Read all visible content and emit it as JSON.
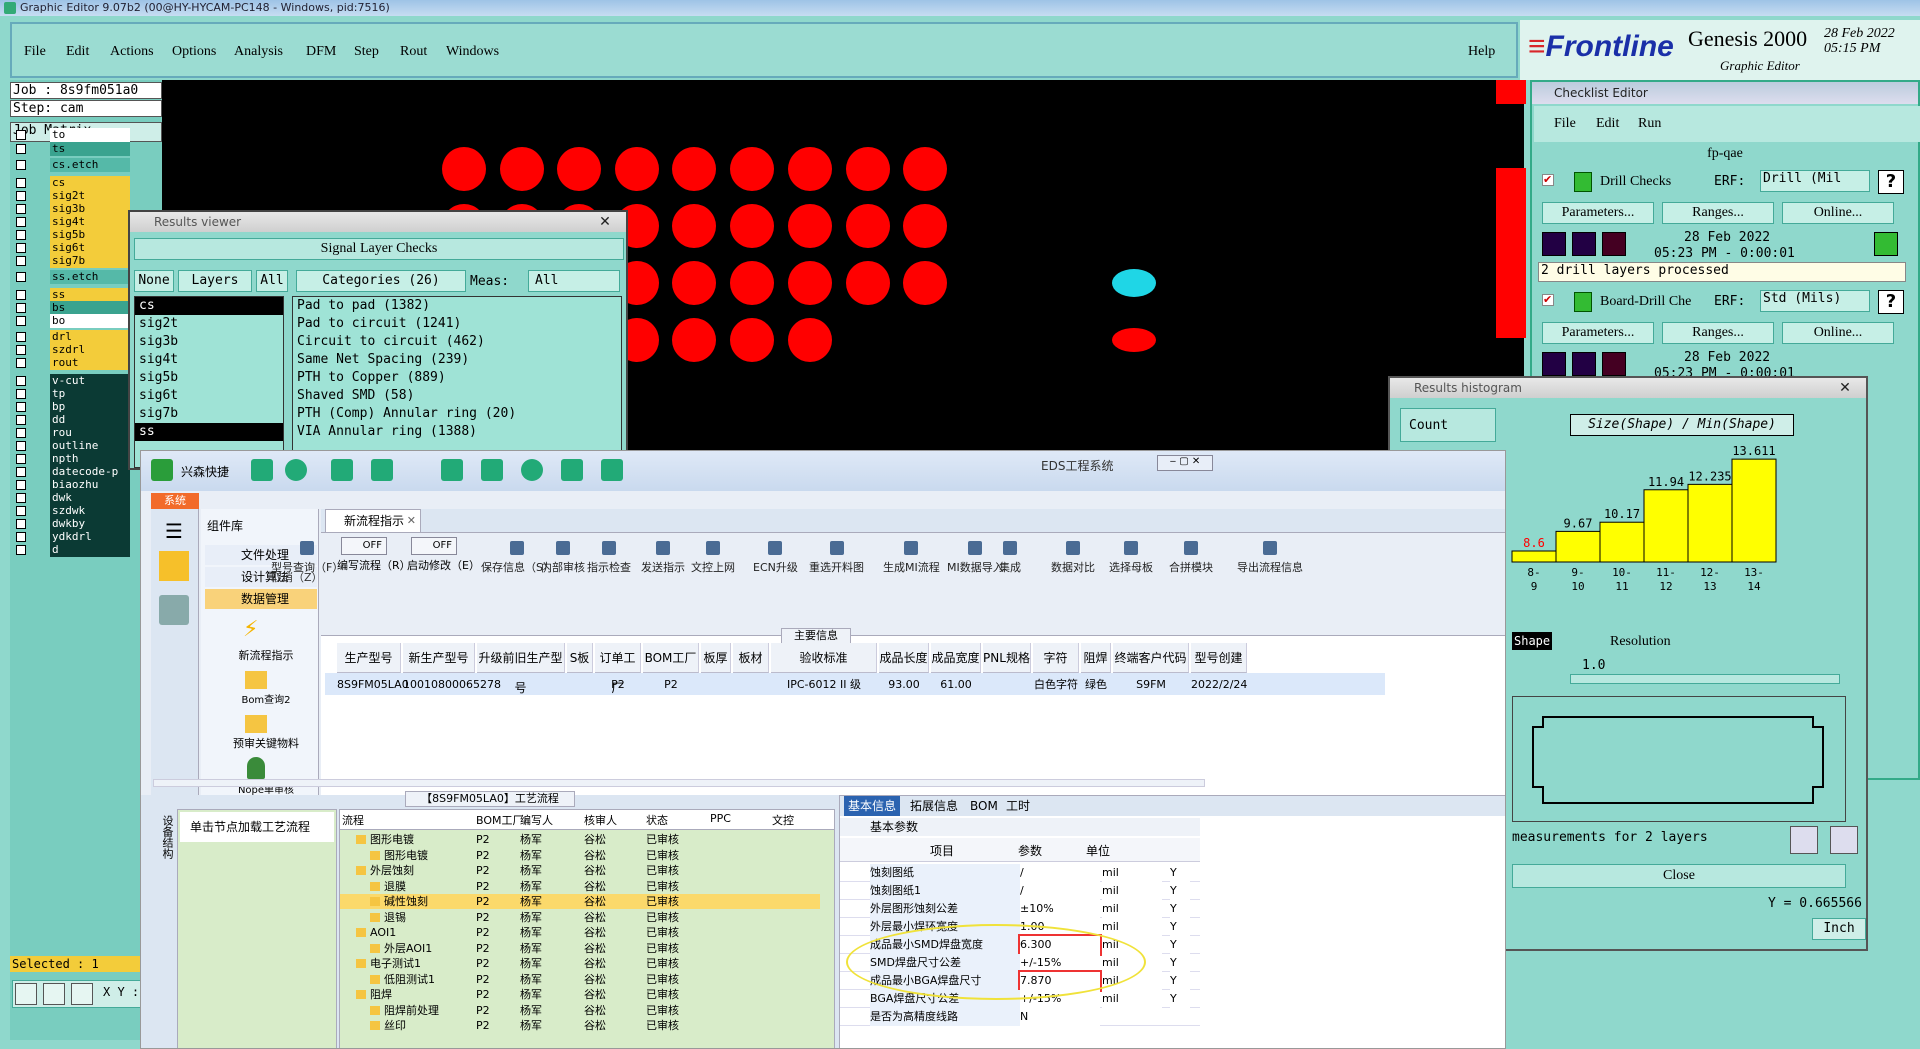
{
  "titlebar": {
    "text": "Graphic Editor 9.07b2 (00@HY-HYCAM-PC148 - Windows, pid:7516)"
  },
  "menu": {
    "items": [
      "File",
      "Edit",
      "Actions",
      "Options",
      "Analysis",
      "DFM",
      "Step",
      "Rout",
      "Windows"
    ],
    "help": "Help"
  },
  "logo": {
    "brand_a": "Frontline",
    "product": "Genesis 2000",
    "date": "28 Feb 2022",
    "time": "05:15 PM",
    "sub": "Graphic Editor"
  },
  "job": {
    "job_line": "Job : 8s9fm051a0",
    "step_line": "Step: cam",
    "matrix_btn": "Job Matrix ..."
  },
  "layers": [
    "to",
    "ts",
    "cs.etch",
    "cs",
    "sig2t",
    "sig3b",
    "sig4t",
    "sig5b",
    "sig6t",
    "sig7b",
    "ss.etch",
    "ss",
    "bs",
    "bo",
    "drl",
    "szdrl",
    "rout",
    "v-cut",
    "tp",
    "bp",
    "dd",
    "rou",
    "outline",
    "npth",
    "datecode-p",
    "biaozhu",
    "dwk",
    "szdwk",
    "dwkby",
    "ydkdrl",
    "d"
  ],
  "status": {
    "selected": "Selected : 1",
    "xy": "X Y :"
  },
  "checklist": {
    "title": "Checklist Editor",
    "menu": [
      "File",
      "Edit",
      "Run"
    ],
    "name": "fp-qae",
    "check1": {
      "name": "Drill Checks",
      "erf": "ERF:",
      "erf_val": "Drill (Mil",
      "params": "Parameters...",
      "ranges": "Ranges...",
      "online": "Online...",
      "date": "28 Feb 2022",
      "time": "05:23 PM - 0:00:01",
      "msg": "2 drill layers processed"
    },
    "check2": {
      "name": "Board-Drill Che",
      "erf": "ERF:",
      "erf_val": "Std (Mils)",
      "params": "Parameters...",
      "ranges": "Ranges...",
      "online": "Online...",
      "date": "28 Feb 2022",
      "time": "05:23 PM - 0:00:01"
    }
  },
  "results_viewer": {
    "title": "Results viewer",
    "section": "Signal Layer Checks",
    "none": "None",
    "layers": "Layers",
    "all": "All",
    "categories": "Categories (26)",
    "meas": "Meas:",
    "meas_val": "All",
    "layer_list": [
      "cs",
      "sig2t",
      "sig3b",
      "sig4t",
      "sig5b",
      "sig6t",
      "sig7b",
      "ss"
    ],
    "category_list": [
      "Pad to pad (1382)",
      "Pad to circuit (1241)",
      "Circuit to circuit (462)",
      "Same Net Spacing (239)",
      "PTH to Copper (889)",
      "Shaved SMD (58)",
      "PTH (Comp) Annular ring (20)",
      "VIA Annular ring (1388)"
    ]
  },
  "histogram": {
    "title": "Results histogram",
    "count": "Count",
    "heading": "Size(Shape) / Min(Shape)",
    "resolution_label": "Resolution",
    "resolution_val": "1.0",
    "shape": "Shape",
    "measurements": "measurements for 2 layers",
    "close": "Close",
    "inch": "Inch",
    "yreadout": "Y = 0.665566"
  },
  "chart_data": {
    "type": "bar",
    "categories": [
      "8-9",
      "9-10",
      "10-11",
      "11-12",
      "12-13",
      "13-14"
    ],
    "values": [
      8.6,
      9.67,
      10.17,
      11.94,
      12.235,
      13.611
    ],
    "title": "Size(Shape) / Min(Shape)",
    "xlabel": "",
    "ylabel": ""
  },
  "eds": {
    "title": "EDS工程系统",
    "app": "兴森快捷",
    "side_tab": "系统",
    "lib": "组件库",
    "side_items": [
      "文件处理",
      "设计算法",
      "数据管理"
    ],
    "side_tools": [
      "新流程指示",
      "Bom查询2",
      "预审关键物料",
      "Nope单审核"
    ],
    "doc_tab": "新流程指示",
    "toggles": [
      {
        "label": "编写流程（R）",
        "state": "OFF"
      },
      {
        "label": "启动修改（E）",
        "state": "OFF"
      }
    ],
    "toolbar": [
      "型号查询（F）",
      "保存信息（S）",
      "内部审核",
      "指示检查",
      "发送指示",
      "文控上网",
      "ECN升级",
      "重选开料图",
      "生成MI流程",
      "MI数据导入",
      "集成",
      "数据对比",
      "选择母板",
      "合拼模块",
      "导出流程信息"
    ],
    "cancel": "取消（Z）",
    "main_info": "主要信息",
    "grid_headers": [
      "生产型号",
      "新生产型号",
      "升级前旧生产型号",
      "S板",
      "订单工厂",
      "BOM工厂",
      "板厚",
      "板材",
      "验收标准",
      "成品长度",
      "成品宽度",
      "PNL规格",
      "字符",
      "阻焊",
      "终端客户代码",
      "型号创建"
    ],
    "grid_row": [
      "8S9FM05LA0",
      "10010800065278",
      "",
      "",
      "P2",
      "P2",
      "",
      "",
      "IPC-6012 II 级",
      "93.00",
      "61.00",
      "",
      "白色字符",
      "绿色",
      "S9FM",
      "2022/2/24"
    ],
    "flow_title": "【8S9FM05LA0】工艺流程",
    "flow_hint": "单击节点加载工艺流程",
    "device_tab": "设备结构",
    "flow_headers": [
      "流程",
      "BOM工厂",
      "编写人",
      "核审人",
      "状态",
      "PPC",
      "文控"
    ],
    "flow_rows": [
      {
        "name": "图形电镀",
        "lvl": 1,
        "f": "P2",
        "w": "杨军",
        "r": "谷松",
        "s": "已审核"
      },
      {
        "name": "图形电镀",
        "lvl": 2,
        "f": "P2",
        "w": "杨军",
        "r": "谷松",
        "s": "已审核"
      },
      {
        "name": "外层蚀刻",
        "lvl": 1,
        "f": "P2",
        "w": "杨军",
        "r": "谷松",
        "s": "已审核"
      },
      {
        "name": "退膜",
        "lvl": 2,
        "f": "P2",
        "w": "杨军",
        "r": "谷松",
        "s": "已审核"
      },
      {
        "name": "碱性蚀刻",
        "lvl": 2,
        "f": "P2",
        "w": "杨军",
        "r": "谷松",
        "s": "已审核"
      },
      {
        "name": "退锡",
        "lvl": 2,
        "f": "P2",
        "w": "杨军",
        "r": "谷松",
        "s": "已审核"
      },
      {
        "name": "AOI1",
        "lvl": 1,
        "f": "P2",
        "w": "杨军",
        "r": "谷松",
        "s": "已审核"
      },
      {
        "name": "外层AOI1",
        "lvl": 2,
        "f": "P2",
        "w": "杨军",
        "r": "谷松",
        "s": "已审核"
      },
      {
        "name": "电子测试1",
        "lvl": 1,
        "f": "P2",
        "w": "杨军",
        "r": "谷松",
        "s": "已审核"
      },
      {
        "name": "低阻测试1",
        "lvl": 2,
        "f": "P2",
        "w": "杨军",
        "r": "谷松",
        "s": "已审核"
      },
      {
        "name": "阻焊",
        "lvl": 1,
        "f": "P2",
        "w": "杨军",
        "r": "谷松",
        "s": "已审核"
      },
      {
        "name": "阻焊前处理",
        "lvl": 2,
        "f": "P2",
        "w": "杨军",
        "r": "谷松",
        "s": "已审核"
      },
      {
        "name": "丝印",
        "lvl": 2,
        "f": "P2",
        "w": "杨军",
        "r": "谷松",
        "s": "已审核"
      }
    ],
    "prop_tabs": [
      "基本信息",
      "拓展信息",
      "BOM",
      "工时"
    ],
    "prop_section": "基本参数",
    "prop_headers": [
      "项目",
      "参数",
      "单位"
    ],
    "props": [
      {
        "k": "蚀刻图纸",
        "v": "/",
        "u": "mil",
        "y": "Y"
      },
      {
        "k": "蚀刻图纸1",
        "v": "/",
        "u": "mil",
        "y": "Y"
      },
      {
        "k": "外层图形蚀刻公差",
        "v": "±10%",
        "u": "mil",
        "y": "Y"
      },
      {
        "k": "外层最小焊环宽度",
        "v": "1.00",
        "u": "mil",
        "y": "Y"
      },
      {
        "k": "成品最小SMD焊盘宽度",
        "v": "6.300",
        "u": "mil",
        "y": "Y"
      },
      {
        "k": "SMD焊盘尺寸公差",
        "v": "+/-15%",
        "u": "mil",
        "y": "Y"
      },
      {
        "k": "成品最小BGA焊盘尺寸",
        "v": "7.870",
        "u": "mil",
        "y": "Y"
      },
      {
        "k": "BGA焊盘尺寸公差",
        "v": "+/-15%",
        "u": "mil",
        "y": "Y"
      },
      {
        "k": "是否为高精度线路",
        "v": "N",
        "u": "",
        "y": ""
      }
    ]
  }
}
